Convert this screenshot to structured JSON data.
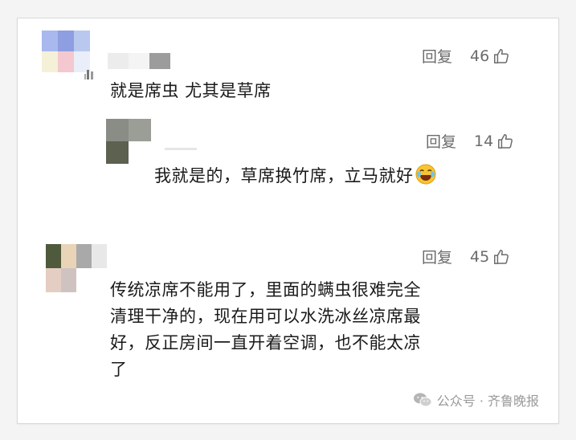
{
  "comments": [
    {
      "reply_label": "回复",
      "likes": "46",
      "text": "就是席虫 尤其是草席"
    },
    {
      "reply_label": "回复",
      "likes": "14",
      "text": "我就是的，草席换竹席，立马就好"
    },
    {
      "reply_label": "回复",
      "likes": "45",
      "text_lines": [
        "传统凉席不能用了，里面的螨虫很难完全",
        "清理干净的，现在用可以水洗冰丝凉席最",
        "好，反正房间一直开着空调，也不能太凉",
        "了"
      ]
    }
  ],
  "watermark": {
    "text": "公众号 · 齐鲁晚报"
  },
  "colors": {
    "text": "#1a1a1a",
    "meta": "#6b6b6b",
    "watermark": "#9a9a9a"
  },
  "icons": [
    "thumbs-up-icon",
    "laugh-emoji-icon",
    "wechat-icon",
    "phone-icon"
  ]
}
